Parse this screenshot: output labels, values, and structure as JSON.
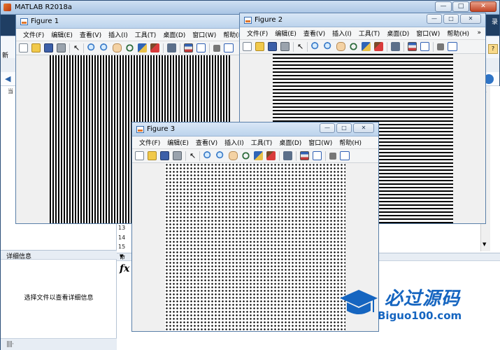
{
  "main_window": {
    "title": "MATLAB R2018a",
    "recent_label": "录",
    "left_tag": "新",
    "current_folder_label": "当",
    "detail_panel_title": "详细信息",
    "detail_panel_text": "选择文件以查看详细信息",
    "detail_footer": "||||·",
    "line_numbers": [
      "13",
      "14",
      "15"
    ],
    "cmd_label": "命",
    "fx_symbol": "fx"
  },
  "window_buttons": {
    "minimize": "—",
    "maximize": "□",
    "close": "✕"
  },
  "figures": [
    {
      "title": "Figure 1",
      "pattern": "vertical-stripes"
    },
    {
      "title": "Figure 2",
      "pattern": "horizontal-stripes"
    },
    {
      "title": "Figure 3",
      "pattern": "dot-grid"
    }
  ],
  "figure_menu": [
    "文件(F)",
    "编辑(E)",
    "查看(V)",
    "插入(I)",
    "工具(T)",
    "桌面(D)",
    "窗口(W)",
    "帮助(H)"
  ],
  "figure_menu_more": "»",
  "watermark": {
    "main": "必过源码",
    "sub": "Biguo100.com",
    "color": "#1565c0"
  }
}
